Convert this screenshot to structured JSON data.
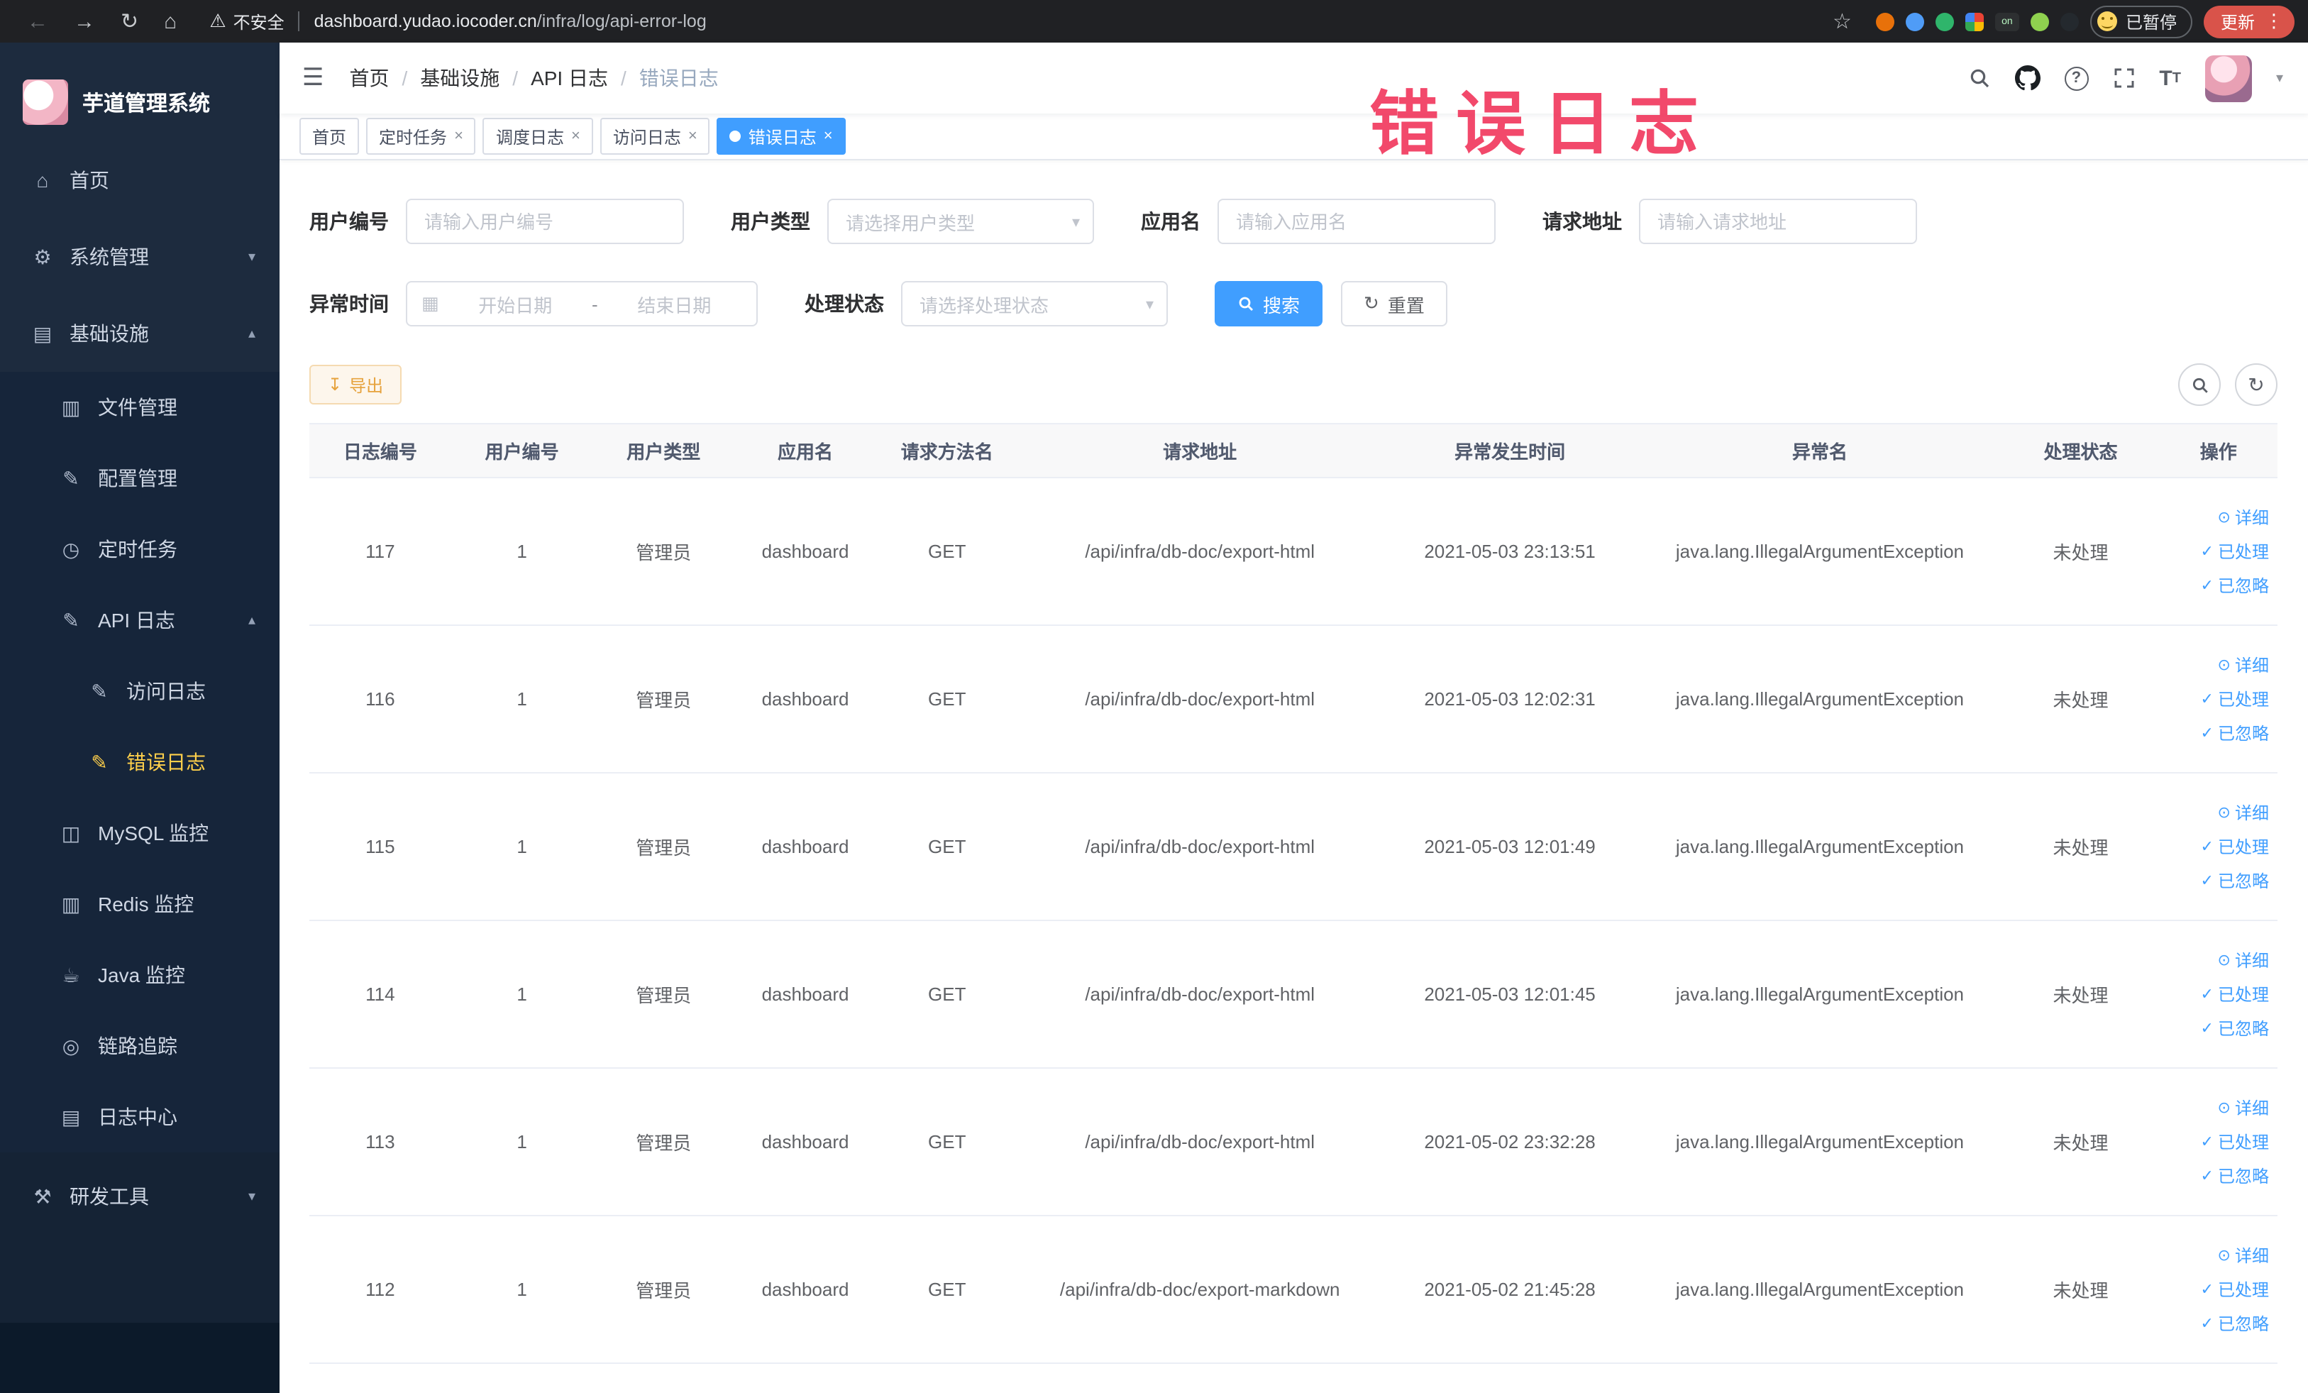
{
  "browser": {
    "security_label": "不安全",
    "url_domain": "dashboard.yudao.iocoder.cn",
    "url_path": "/infra/log/api-error-log",
    "profile_badge": "已暂停",
    "update_button": "更新",
    "ext_on_badge": "on"
  },
  "annotation": {
    "text": "错误日志"
  },
  "icons": {
    "back": "←",
    "forward": "→",
    "reload": "↻",
    "home": "⌂",
    "warning": "⚠",
    "star": "☆",
    "kebab": "⋮",
    "hamburger": "☰",
    "caret_down": "▾",
    "caret_up": "▴",
    "close": "×",
    "calendar": "▦",
    "download": "↧",
    "refresh": "↻",
    "detail": "⊙",
    "check": "✓",
    "question": "?",
    "menu_home": "⌂",
    "menu_system": "⚙",
    "menu_infra": "▤",
    "menu_file": "▥",
    "menu_config": "✎",
    "menu_job": "◷",
    "menu_apilog": "✎",
    "menu_access": "✎",
    "menu_error": "✎",
    "menu_mysql": "◫",
    "menu_redis": "▥",
    "menu_java": "☕",
    "menu_trace": "◎",
    "menu_logcenter": "▤",
    "menu_tools": "⚒"
  },
  "sidebar": {
    "title": "芋道管理系统",
    "items": [
      {
        "label": "首页"
      },
      {
        "label": "系统管理"
      },
      {
        "label": "基础设施"
      },
      {
        "label": "文件管理"
      },
      {
        "label": "配置管理"
      },
      {
        "label": "定时任务"
      },
      {
        "label": "API 日志"
      },
      {
        "label": "访问日志"
      },
      {
        "label": "错误日志"
      },
      {
        "label": "MySQL 监控"
      },
      {
        "label": "Redis 监控"
      },
      {
        "label": "Java 监控"
      },
      {
        "label": "链路追踪"
      },
      {
        "label": "日志中心"
      },
      {
        "label": "研发工具"
      }
    ]
  },
  "breadcrumb": {
    "separator": "/",
    "items": [
      "首页",
      "基础设施",
      "API 日志",
      "错误日志"
    ]
  },
  "tabs": [
    {
      "label": "首页"
    },
    {
      "label": "定时任务"
    },
    {
      "label": "调度日志"
    },
    {
      "label": "访问日志"
    },
    {
      "label": "错误日志"
    }
  ],
  "filters": {
    "user_id": {
      "label": "用户编号",
      "placeholder": "请输入用户编号"
    },
    "user_type": {
      "label": "用户类型",
      "placeholder": "请选择用户类型"
    },
    "app_name": {
      "label": "应用名",
      "placeholder": "请输入应用名"
    },
    "request_url": {
      "label": "请求地址",
      "placeholder": "请输入请求地址"
    },
    "exception_time": {
      "label": "异常时间",
      "start_placeholder": "开始日期",
      "end_placeholder": "结束日期",
      "separator": "-"
    },
    "process_status": {
      "label": "处理状态",
      "placeholder": "请选择处理状态"
    },
    "search_button": "搜索",
    "reset_button": "重置"
  },
  "toolbar": {
    "export_button": "导出"
  },
  "table": {
    "columns": [
      "日志编号",
      "用户编号",
      "用户类型",
      "应用名",
      "请求方法名",
      "请求地址",
      "异常发生时间",
      "异常名",
      "处理状态",
      "操作"
    ],
    "actions": {
      "detail": "详细",
      "process": "已处理",
      "ignore": "已忽略"
    },
    "rows": [
      {
        "id": "117",
        "user_id": "1",
        "user_type": "管理员",
        "app": "dashboard",
        "method": "GET",
        "url": "/api/infra/db-doc/export-html",
        "time": "2021-05-03 23:13:51",
        "exception": "java.lang.IllegalArgumentException",
        "status": "未处理"
      },
      {
        "id": "116",
        "user_id": "1",
        "user_type": "管理员",
        "app": "dashboard",
        "method": "GET",
        "url": "/api/infra/db-doc/export-html",
        "time": "2021-05-03 12:02:31",
        "exception": "java.lang.IllegalArgumentException",
        "status": "未处理"
      },
      {
        "id": "115",
        "user_id": "1",
        "user_type": "管理员",
        "app": "dashboard",
        "method": "GET",
        "url": "/api/infra/db-doc/export-html",
        "time": "2021-05-03 12:01:49",
        "exception": "java.lang.IllegalArgumentException",
        "status": "未处理"
      },
      {
        "id": "114",
        "user_id": "1",
        "user_type": "管理员",
        "app": "dashboard",
        "method": "GET",
        "url": "/api/infra/db-doc/export-html",
        "time": "2021-05-03 12:01:45",
        "exception": "java.lang.IllegalArgumentException",
        "status": "未处理"
      },
      {
        "id": "113",
        "user_id": "1",
        "user_type": "管理员",
        "app": "dashboard",
        "method": "GET",
        "url": "/api/infra/db-doc/export-html",
        "time": "2021-05-02 23:32:28",
        "exception": "java.lang.IllegalArgumentException",
        "status": "未处理"
      },
      {
        "id": "112",
        "user_id": "1",
        "user_type": "管理员",
        "app": "dashboard",
        "method": "GET",
        "url": "/api/infra/db-doc/export-markdown",
        "time": "2021-05-02 21:45:28",
        "exception": "java.lang.IllegalArgumentException",
        "status": "未处理"
      }
    ]
  }
}
